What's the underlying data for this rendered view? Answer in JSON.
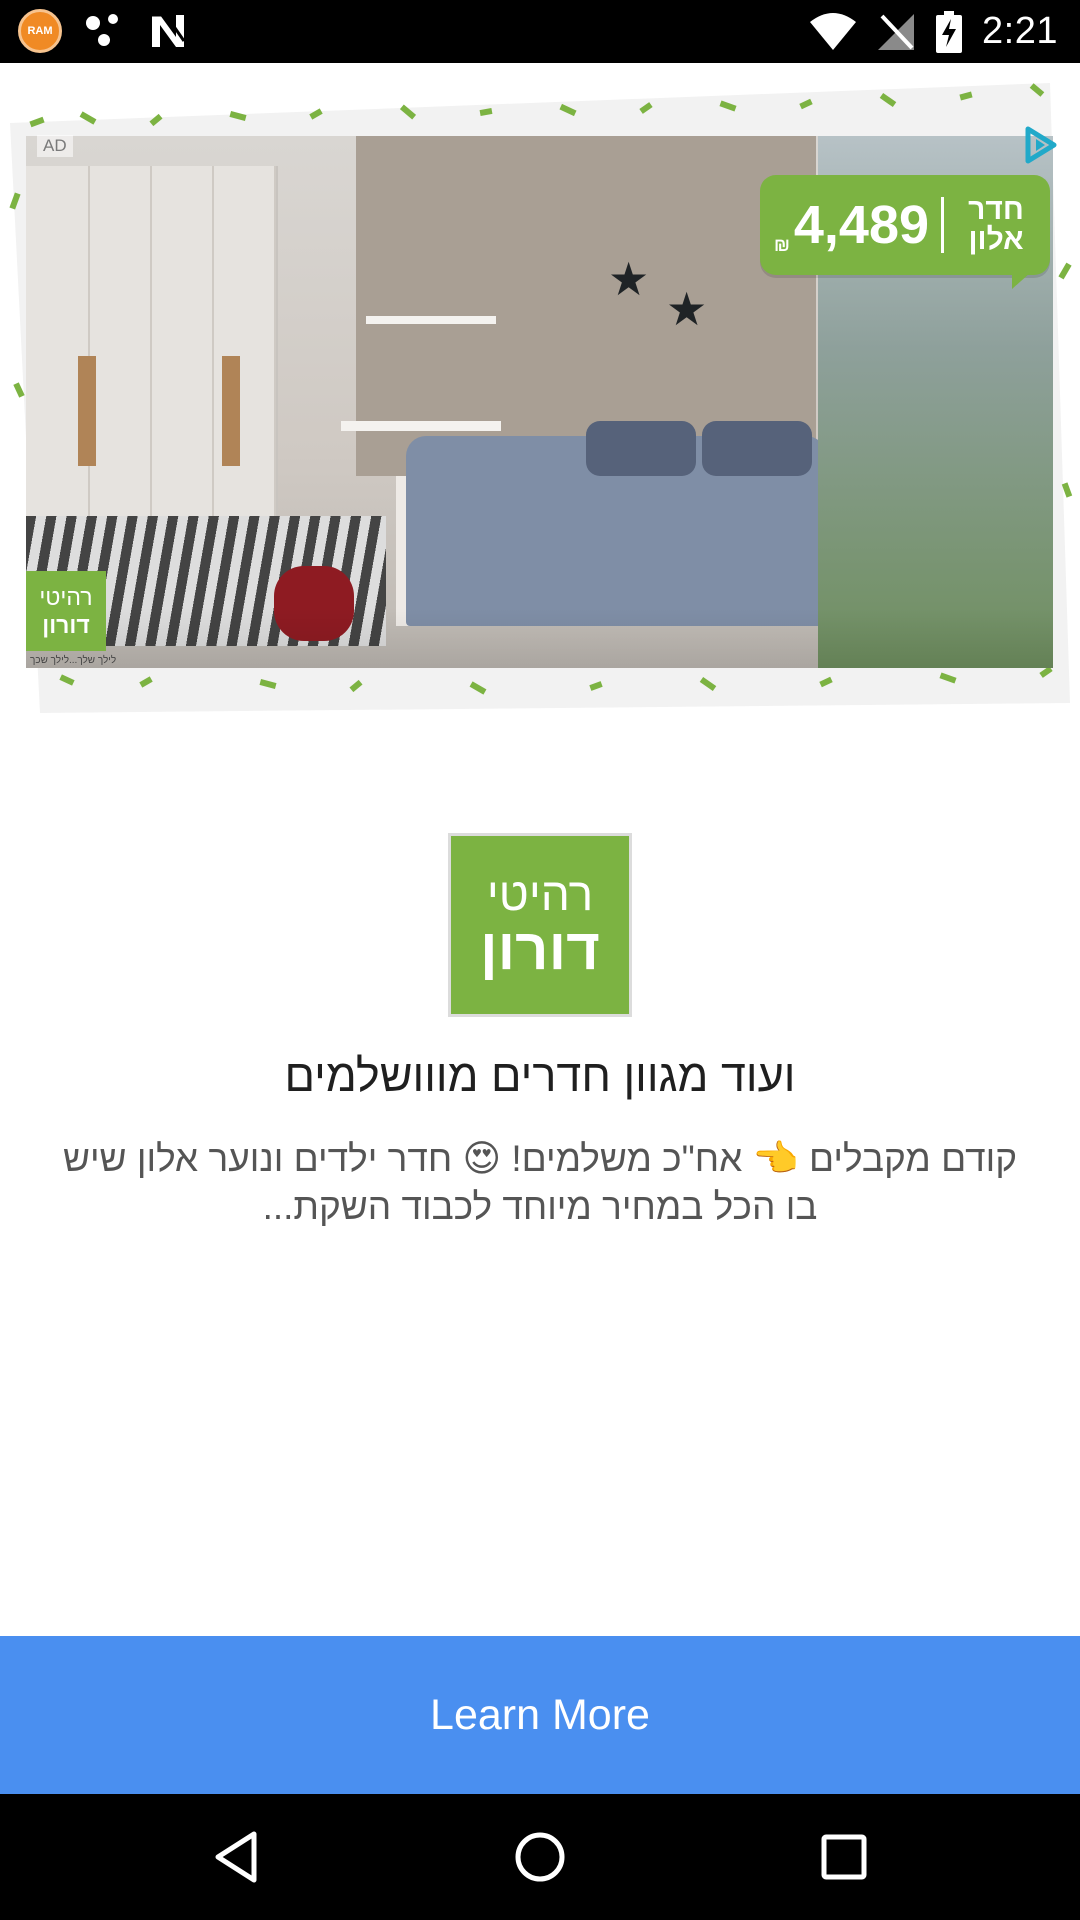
{
  "status_bar": {
    "ram_icon_label": "RAM",
    "time": "2:21",
    "icons": [
      "ram-icon",
      "dots-icon",
      "n-icon",
      "wifi-icon",
      "no-signal-icon",
      "battery-charging-icon"
    ]
  },
  "ad": {
    "badge": "AD",
    "adchoices_icon": "play-triangle-icon",
    "price_label": "חדר אלון",
    "price_value": "4,489",
    "price_currency": "₪",
    "brand_logo_line1": "רהיטי",
    "brand_logo_line2": "דורון",
    "fine_print": "לילך שלך...לילך שכך"
  },
  "app_logo": {
    "line1": "רהיטי",
    "line2": "דורון"
  },
  "headline": "ועוד מגוון חדרים מווושלמים",
  "body": "קודם מקבלים 👈 אח\"כ משלמים! 😍 חדר ילדים ונוער אלון שיש בו הכל במחיר מיוחד לכבוד השקת...",
  "cta": {
    "label": "Learn More"
  },
  "colors": {
    "brand_green": "#7cb342",
    "cta_blue": "#4a8ff0",
    "adchoices_teal": "#21a9c9"
  },
  "nav": {
    "icons": [
      "back-icon",
      "home-icon",
      "recents-icon"
    ]
  }
}
